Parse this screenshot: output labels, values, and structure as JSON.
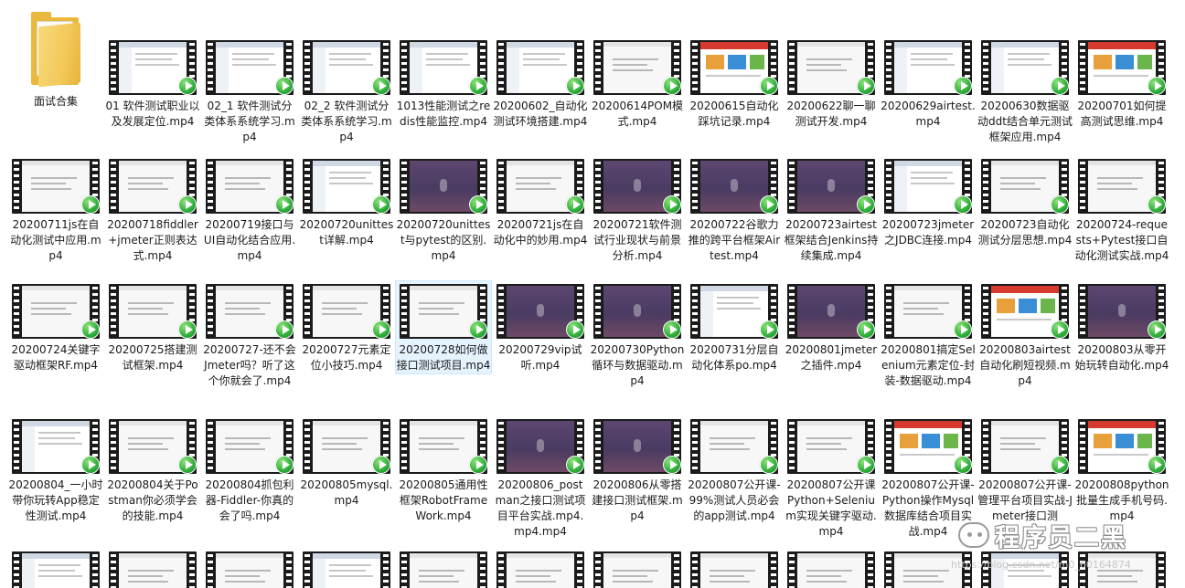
{
  "files": [
    {
      "label": "面试合集",
      "type": "folder"
    },
    {
      "label": "01 软件测试职业以及发展定位.mp4",
      "type": "video",
      "thumb": "window"
    },
    {
      "label": "02_1 软件测试分类体系系统学习.mp4",
      "type": "video",
      "thumb": "window"
    },
    {
      "label": "02_2 软件测试分类体系系统学习.mp4",
      "type": "video",
      "thumb": "window"
    },
    {
      "label": "1013性能测试之redis性能监控.mp4",
      "type": "video",
      "thumb": "window"
    },
    {
      "label": "20200602_自动化测试环境搭建.mp4",
      "type": "video",
      "thumb": "window"
    },
    {
      "label": "20200614POM模式.mp4",
      "type": "video",
      "thumb": "white"
    },
    {
      "label": "20200615自动化踩坑记录.mp4",
      "type": "video",
      "thumb": "colorful"
    },
    {
      "label": "20200622聊一聊测试开发.mp4",
      "type": "video",
      "thumb": "white"
    },
    {
      "label": "20200629airtest.mp4",
      "type": "video",
      "thumb": "window"
    },
    {
      "label": "20200630数据驱动ddt结合单元测试框架应用.mp4",
      "type": "video",
      "thumb": "window"
    },
    {
      "label": "20200701如何提高测试思维.mp4",
      "type": "video",
      "thumb": "colorful"
    },
    {
      "label": "20200711js在自动化测试中应用.mp4",
      "type": "video",
      "thumb": "white"
    },
    {
      "label": "20200718fiddler+jmeter正则表达式.mp4",
      "type": "video",
      "thumb": "white"
    },
    {
      "label": "20200719接口与UI自动化结合应用.mp4",
      "type": "video",
      "thumb": "white"
    },
    {
      "label": "20200720unittest详解.mp4",
      "type": "video",
      "thumb": "window"
    },
    {
      "label": "20200720unittest与pytest的区别.mp4",
      "type": "video",
      "thumb": "purple"
    },
    {
      "label": "20200721js在自动化中的妙用.mp4",
      "type": "video",
      "thumb": "white"
    },
    {
      "label": "20200721软件测试行业现状与前景分析.mp4",
      "type": "video",
      "thumb": "purple"
    },
    {
      "label": "20200722谷歌力推的跨平台框架Airtest.mp4",
      "type": "video",
      "thumb": "purple"
    },
    {
      "label": "20200723airtest框架结合Jenkins持续集成.mp4",
      "type": "video",
      "thumb": "purple"
    },
    {
      "label": "20200723jmeter之JDBC连接.mp4",
      "type": "video",
      "thumb": "window"
    },
    {
      "label": "20200723自动化测试分层思想.mp4",
      "type": "video",
      "thumb": "white"
    },
    {
      "label": "20200724-requests+Pytest接口自动化测试实战.mp4",
      "type": "video",
      "thumb": "white"
    },
    {
      "label": "20200724关键字驱动框架RF.mp4",
      "type": "video",
      "thumb": "white"
    },
    {
      "label": "20200725搭建测试框架.mp4",
      "type": "video",
      "thumb": "white"
    },
    {
      "label": "20200727-还不会Jmeter吗？听了这个你就会了.mp4",
      "type": "video",
      "thumb": "white"
    },
    {
      "label": "20200727元素定位小技巧.mp4",
      "type": "video",
      "thumb": "white"
    },
    {
      "label": "20200728如何做接口测试项目.mp4",
      "type": "video",
      "thumb": "white",
      "selected": true
    },
    {
      "label": "20200729vip试听.mp4",
      "type": "video",
      "thumb": "purple"
    },
    {
      "label": "20200730Python循环与数据驱动.mp4",
      "type": "video",
      "thumb": "purple"
    },
    {
      "label": "20200731分层自动化体系po.mp4",
      "type": "video",
      "thumb": "window"
    },
    {
      "label": "20200801jmeter之插件.mp4",
      "type": "video",
      "thumb": "purple"
    },
    {
      "label": "20200801搞定Selenium元素定位-封装-数据驱动.mp4",
      "type": "video",
      "thumb": "white"
    },
    {
      "label": "20200803airtest自动化刷短视频.mp4",
      "type": "video",
      "thumb": "colorful"
    },
    {
      "label": "20200803从零开始玩转自动化.mp4",
      "type": "video",
      "thumb": "purple"
    },
    {
      "label": "20200804_一小时带你玩转App稳定性测试.mp4",
      "type": "video",
      "thumb": "window"
    },
    {
      "label": "20200804关于Postman你必须学会的技能.mp4",
      "type": "video",
      "thumb": "white"
    },
    {
      "label": "20200804抓包利器-Fiddler-你真的会了吗.mp4",
      "type": "video",
      "thumb": "white"
    },
    {
      "label": "20200805mysql.mp4",
      "type": "video",
      "thumb": "white"
    },
    {
      "label": "20200805通用性框架RobotFrameWork.mp4",
      "type": "video",
      "thumb": "white"
    },
    {
      "label": "20200806_postman之接口测试项目平台实战.mp4.mp4.mp4",
      "type": "video",
      "thumb": "purple"
    },
    {
      "label": "20200806从零搭建接口测试框架.mp4",
      "type": "video",
      "thumb": "purple"
    },
    {
      "label": "20200807公开课-99%测试人员必会的app测试.mp4",
      "type": "video",
      "thumb": "white"
    },
    {
      "label": "20200807公开课Python+Selenium实现关键字驱动.mp4",
      "type": "video",
      "thumb": "white"
    },
    {
      "label": "20200807公开课-Python操作Mysql数据库结合项目实战.mp4",
      "type": "video",
      "thumb": "colorful"
    },
    {
      "label": "20200807公开课-管理平台项目实战-Jmeter接口测",
      "type": "video",
      "thumb": "white"
    },
    {
      "label": "20200808python批量生成手机号码.mp4",
      "type": "video",
      "thumb": "colorful"
    },
    {
      "label": "",
      "type": "video",
      "thumb": "window"
    },
    {
      "label": "",
      "type": "video",
      "thumb": "white"
    },
    {
      "label": "",
      "type": "video",
      "thumb": "white"
    },
    {
      "label": "",
      "type": "video",
      "thumb": "window"
    },
    {
      "label": "",
      "type": "video",
      "thumb": "white"
    },
    {
      "label": "",
      "type": "video",
      "thumb": "white"
    },
    {
      "label": "",
      "type": "video",
      "thumb": "white"
    },
    {
      "label": "",
      "type": "video",
      "thumb": "white"
    },
    {
      "label": "",
      "type": "video",
      "thumb": "white"
    },
    {
      "label": "",
      "type": "video",
      "thumb": "white"
    },
    {
      "label": "",
      "type": "video",
      "thumb": "window"
    },
    {
      "label": "",
      "type": "video",
      "thumb": "white"
    }
  ],
  "watermark": {
    "brand": "程序员二黑",
    "url": "https://blog.csdn.net/m0_60164874",
    "icon": "wechat-icon"
  }
}
